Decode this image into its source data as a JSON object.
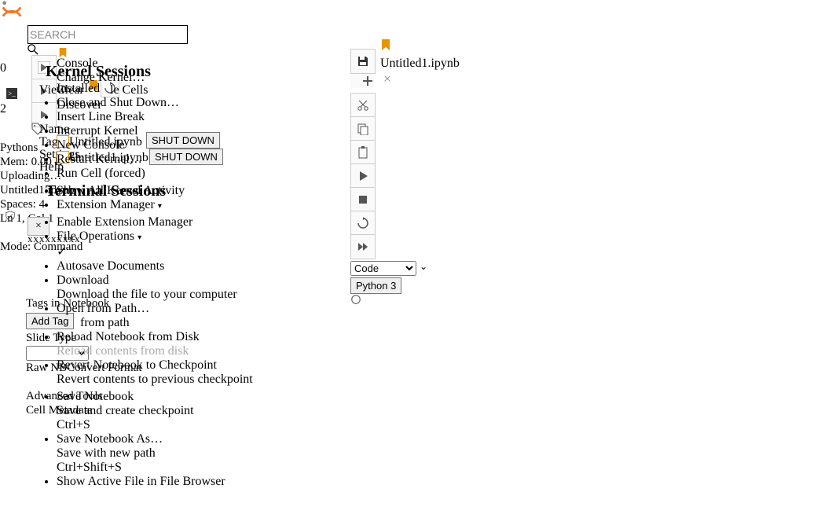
{
  "search_placeholder": "SEARCH",
  "sidebar": {
    "kernel_sessions_heading": "Kernel Sessions",
    "terminal_sessions_heading": "Terminal Sessions",
    "shutdown_label": "SHUT DOWN",
    "items": {
      "pythons": "Pythons",
      "untitled1": "Untitled1.ipynb",
      "untitled2": "Untitled.ipynb"
    },
    "status": {
      "zero": "0",
      "two": "2",
      "mem": "Mem: 0.00 B",
      "uploading": "Uploading…",
      "untitled_line": "Untitled1.ipynb",
      "spaces": "Spaces: 4",
      "lncol": "Ln 1, Col 1",
      "xxxx": "xxxxxxxxx",
      "mode": "Mode: Command",
      "tags": "Tags in Notebook",
      "addtag": "Add Tag",
      "slide": "Slide Type",
      "raw": "Raw NBConvert Format",
      "adv": "Advanced Tools",
      "cellmeta": "Cell Metadata",
      "name": "Name",
      "tagslabel": "Tags",
      "settings": "Settings",
      "view": "View",
      "help": "Help",
      "discover": "Discover"
    }
  },
  "menu": {
    "console": "Console",
    "change_kernel": "Change Kernel…",
    "installed": "Installed",
    "clear": "Clear",
    "clear_cells": "le Cells",
    "close_shutdown": "Close and Shut Down…",
    "insert_line_break": "Insert Line Break",
    "interrupt_kernel": "Interrupt Kernel",
    "new_console": "New Console",
    "restart_kernel": "Restart Kernel…",
    "run_cell_forced": "Run Cell (forced)",
    "show_all_kernel": "Show All Kernel Activity",
    "ext_manager": "Extension Manager",
    "enable_ext_manager": "Enable Extension Manager",
    "file_ops": "File Operations",
    "autosave": "Autosave Documents",
    "download": "Download",
    "download_desc": "Download the file to your computer",
    "open_from_path": "Open from Path…",
    "from_path": "from path",
    "reload_from_disk": "Reload Notebook from Disk",
    "reload_contents": "Reload contents from disk",
    "revert_checkpoint": "Revert Notebook to Checkpoint",
    "revert_desc": "Revert contents to previous checkpoint",
    "save_notebook": "Save Notebook",
    "save_desc": "Save and create checkpoint",
    "save_shortcut": "Ctrl+S",
    "save_as": "Save Notebook As…",
    "save_as_desc": "Save with new path",
    "save_as_shortcut": "Ctrl+Shift+S",
    "show_active": "Show Active File in File Browser"
  },
  "tab": {
    "title": "Untitled1.ipynb",
    "close": "×"
  },
  "toolbar": {
    "celltype": "Code",
    "kernel": "Python 3"
  }
}
